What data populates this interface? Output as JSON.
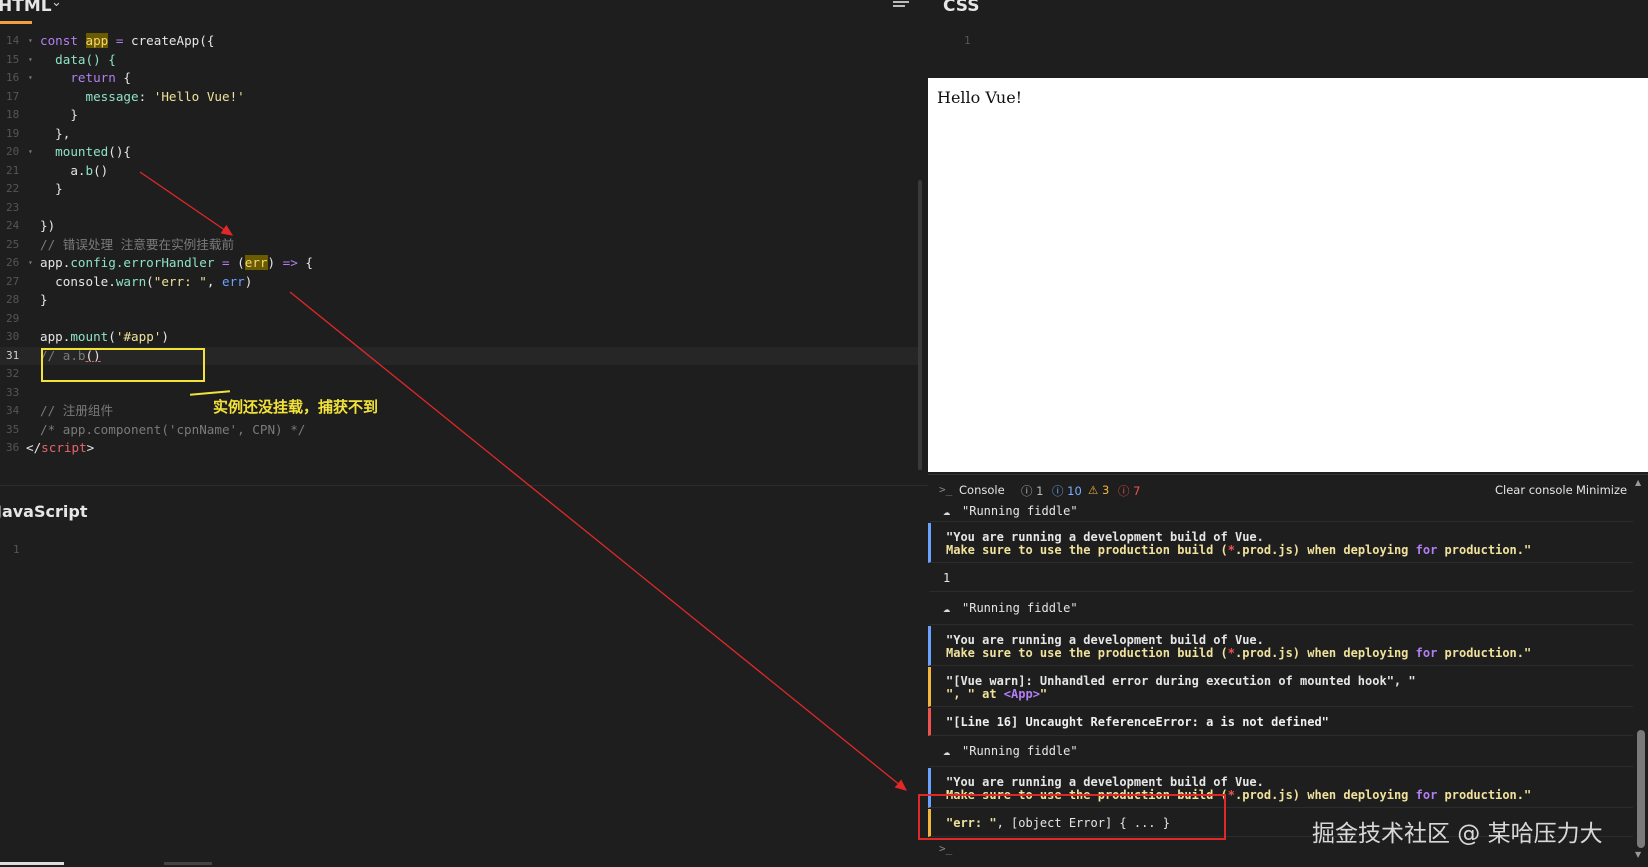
{
  "html_panel": {
    "title": "HTML",
    "lines": [
      {
        "n": "14",
        "fold": true
      },
      {
        "n": "15",
        "fold": true
      },
      {
        "n": "16",
        "fold": true
      },
      {
        "n": "17",
        "fold": false
      },
      {
        "n": "18",
        "fold": false
      },
      {
        "n": "19",
        "fold": false
      },
      {
        "n": "20",
        "fold": true
      },
      {
        "n": "21",
        "fold": false
      },
      {
        "n": "22",
        "fold": false
      },
      {
        "n": "23",
        "fold": false
      },
      {
        "n": "24",
        "fold": false
      },
      {
        "n": "25",
        "fold": false
      },
      {
        "n": "26",
        "fold": true
      },
      {
        "n": "27",
        "fold": false
      },
      {
        "n": "28",
        "fold": false
      },
      {
        "n": "29",
        "fold": false
      },
      {
        "n": "30",
        "fold": false
      },
      {
        "n": "31",
        "fold": false
      },
      {
        "n": "32",
        "fold": false
      },
      {
        "n": "33",
        "fold": false
      },
      {
        "n": "34",
        "fold": false
      },
      {
        "n": "35",
        "fold": false
      },
      {
        "n": "36",
        "fold": false
      }
    ],
    "code": {
      "l14_kw": "const ",
      "l14_var": "app",
      "l14_op": " = ",
      "l14_rest": "createApp({",
      "l15": "  data() {",
      "l16_kw": "    return",
      "l16_rest": " {",
      "l17_prop": "      message",
      "l17_colon": ": ",
      "l17_str": "'Hello Vue!'",
      "l18": "    }",
      "l19": "  },",
      "l20_prop": "  mounted",
      "l20_rest": "(){",
      "l21_a": "    a.",
      "l21_b": "b",
      "l21_rest": "()",
      "l22": "  }",
      "l23": "",
      "l24": "})",
      "l25_cmt": "// 错误处理 注意要在实例挂载前",
      "l26_a": "app.",
      "l26_prop": "config.errorHandler",
      "l26_op": " = ",
      "l26_paren": "(",
      "l26_err": "err",
      "l26_close": ") ",
      "l26_arrow": "=>",
      "l26_rest": " {",
      "l27_a": "  console.",
      "l27_prop": "warn",
      "l27_p": "(",
      "l27_str": "\"err: \"",
      "l27_comma": ", ",
      "l27_err": "err",
      "l27_close": ")",
      "l28": "}",
      "l29": "",
      "l30_a": "app.",
      "l30_prop": "mount",
      "l30_p": "(",
      "l30_str": "'#app'",
      "l30_close": ")",
      "l31_cmt": "// a.b",
      "l31_paren": "()",
      "l32": "",
      "l33": "",
      "l34_cmt": "// 注册组件",
      "l35_cmt": "/* app.component('cpnName', CPN) */",
      "l36_open": "</",
      "l36_tag": "script",
      "l36_close": ">"
    },
    "annotation_text": "实例还没挂载，捕获不到"
  },
  "js_panel": {
    "title": "JavaScript",
    "line1": "1"
  },
  "css_panel": {
    "title": "CSS",
    "line1": "1"
  },
  "preview": {
    "text": "Hello Vue!"
  },
  "console": {
    "label": "Console",
    "counts": {
      "log": "1",
      "info": "10",
      "warn": "3",
      "error": "7"
    },
    "clear_label": "Clear console",
    "minimize_label": "Minimize",
    "running": "\"Running fiddle\"",
    "dev_build_1": "\"You are running a development build of Vue.",
    "dev_build_2a": "Make sure to use the production build (",
    "dev_build_2b": "*",
    "dev_build_2c": ".prod.js) when deploying ",
    "dev_build_2d": "for",
    "dev_build_2e": " production.\"",
    "log_one": "1",
    "vue_warn_1": "\"[Vue warn]: Unhandled error during execution of mounted hook\", \"",
    "vue_warn_2a": "\", \" at ",
    "vue_warn_2b": "<App>",
    "vue_warn_2c": "\"",
    "ref_error": "\"[Line 16] Uncaught ReferenceError: a is not defined\"",
    "err_a": "\"err: \"",
    "err_b": ", [object Error] { ... }",
    "input_prompt": ">_"
  },
  "watermark": "掘金技术社区 @ 某哈压力大",
  "colors": {
    "bg": "#1e1e1e",
    "annotation_yellow": "#f2e23a",
    "annotation_red": "#e02828",
    "info_blue": "#6aa2ff",
    "warn_orange": "#f2b53d",
    "error_red": "#ef5350"
  }
}
